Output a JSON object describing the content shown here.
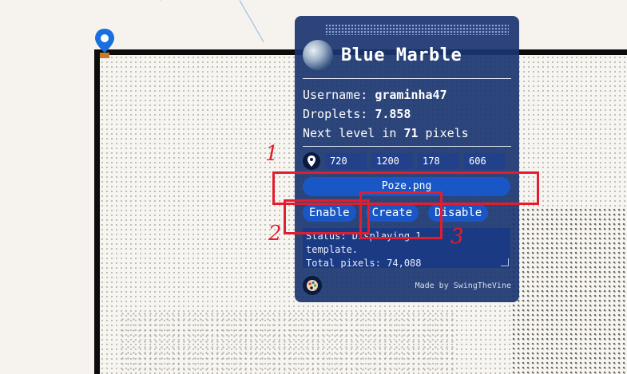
{
  "panel": {
    "title": "Blue Marble",
    "username_label": "Username:",
    "username_value": "graminha47",
    "droplets_label": "Droplets:",
    "droplets_value": "7.858",
    "next_level_prefix": "Next level in",
    "next_level_value": "71",
    "next_level_suffix": "pixels",
    "coords": [
      "720",
      "1200",
      "178",
      "606"
    ],
    "file_button": "Poze.png",
    "buttons": {
      "enable": "Enable",
      "create": "Create",
      "disable": "Disable"
    },
    "status_lines": [
      "Status: Displaying 1",
      "template.",
      "Total pixels: 74,088"
    ],
    "made_by": "Made by SwingTheVine"
  },
  "annotations": {
    "one": "1",
    "two": "2",
    "three": "3"
  },
  "colors": {
    "panel_bg": "#1a3570",
    "button_blue": "#1957c6",
    "annotation_red": "#e21e2e"
  },
  "icons": {
    "map_pin": "map-pin-icon",
    "globe": "globe-icon",
    "coords_pin": "location-pin-icon",
    "palette": "palette-icon"
  }
}
